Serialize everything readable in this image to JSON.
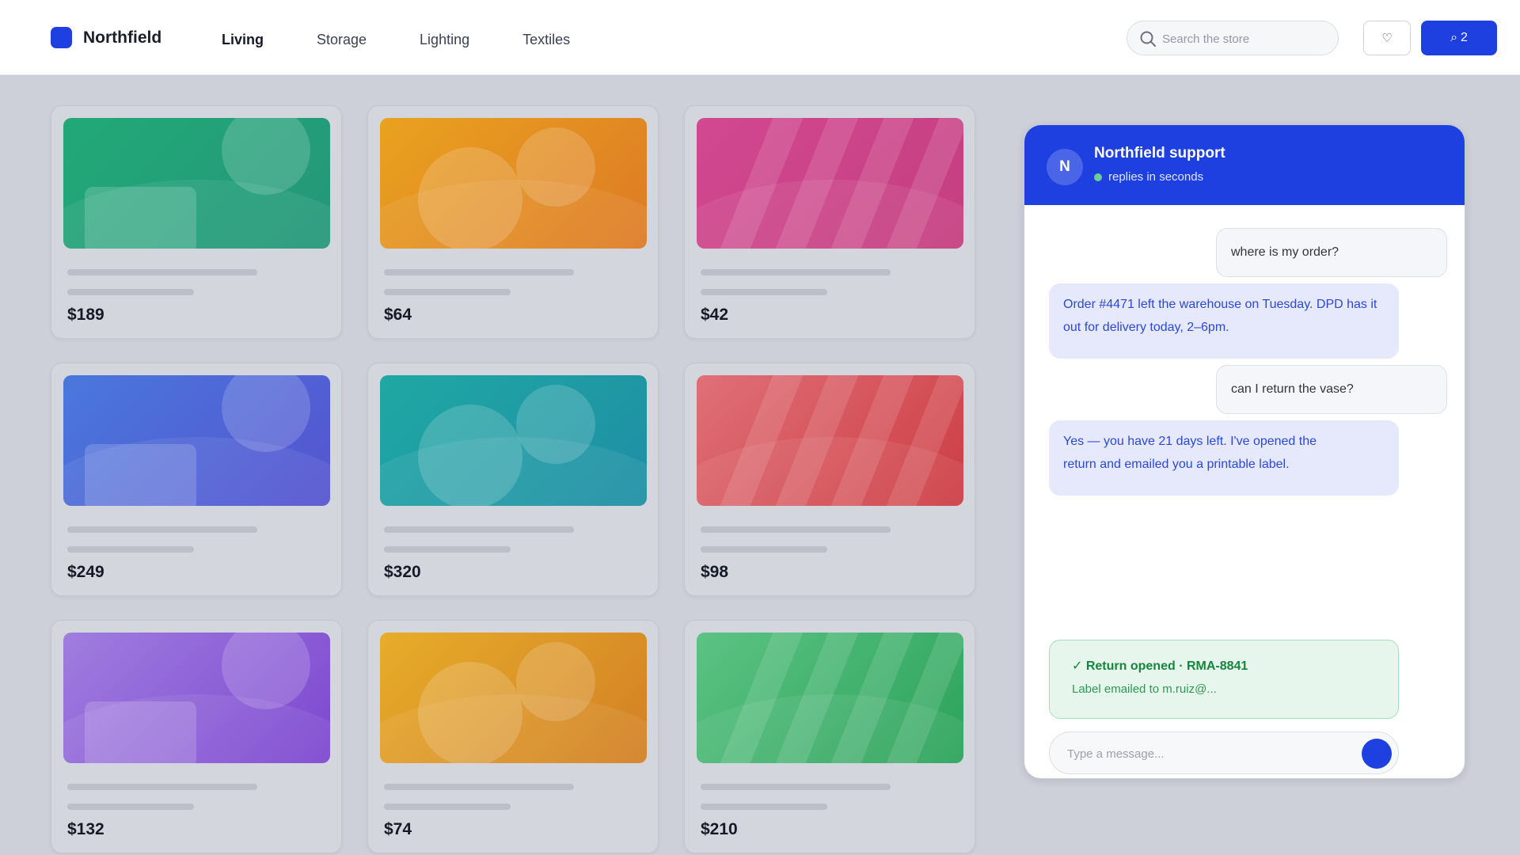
{
  "brand": {
    "name": "Northfield",
    "color": "#1f40e0"
  },
  "nav": {
    "items": [
      "Living",
      "Storage",
      "Lighting",
      "Textiles"
    ],
    "active": "Living"
  },
  "search": {
    "placeholder": "Search the store",
    "icon": "search-icon"
  },
  "header_actions": {
    "favorites_icon": "heart-icon",
    "favorites_label": "♡",
    "cart_icon": "cart-icon",
    "cart_glyph": "⌕",
    "cart_count": "2"
  },
  "products": [
    {
      "price": "$189",
      "colors": [
        "#22a978",
        "#249679"
      ],
      "pattern": "circle-rect"
    },
    {
      "price": "$64",
      "colors": [
        "#e9a21f",
        "#dd7a25"
      ],
      "pattern": "circles"
    },
    {
      "price": "$42",
      "colors": [
        "#d24891",
        "#c43e7f"
      ],
      "pattern": "stripes"
    },
    {
      "price": "$249",
      "colors": [
        "#4a78dd",
        "#5553cf"
      ],
      "pattern": "circle-rect"
    },
    {
      "price": "$320",
      "colors": [
        "#1fa8a3",
        "#1f8ea5"
      ],
      "pattern": "circles"
    },
    {
      "price": "$98",
      "colors": [
        "#e07078",
        "#cc3c42"
      ],
      "pattern": "stripes"
    },
    {
      "price": "$132",
      "colors": [
        "#a07edf",
        "#7c46cf"
      ],
      "pattern": "circle-rect"
    },
    {
      "price": "$74",
      "colors": [
        "#e7ad2a",
        "#d27f24"
      ],
      "pattern": "circles"
    },
    {
      "price": "$210",
      "colors": [
        "#5cc384",
        "#2ba25a"
      ],
      "pattern": "stripes"
    }
  ],
  "chat": {
    "avatar": "N",
    "title": "Northfield support",
    "status": "replies in seconds",
    "messages": [
      {
        "from": "user",
        "text": "where is my order?"
      },
      {
        "from": "agent",
        "text": "Order #4471 left the warehouse on Tuesday. DPD has it out for delivery today, 2–6pm."
      },
      {
        "from": "user",
        "text": "can I return the vase?"
      },
      {
        "from": "agent",
        "text": "Yes — you have 21 days left. I've opened the return and emailed you a printable label."
      }
    ],
    "return_card": {
      "title": "✓ Return opened · RMA-8841",
      "subtitle": "Label emailed to m.ruiz@..."
    },
    "composer": {
      "placeholder": "Type a message..."
    },
    "send_icon": "send-icon"
  }
}
